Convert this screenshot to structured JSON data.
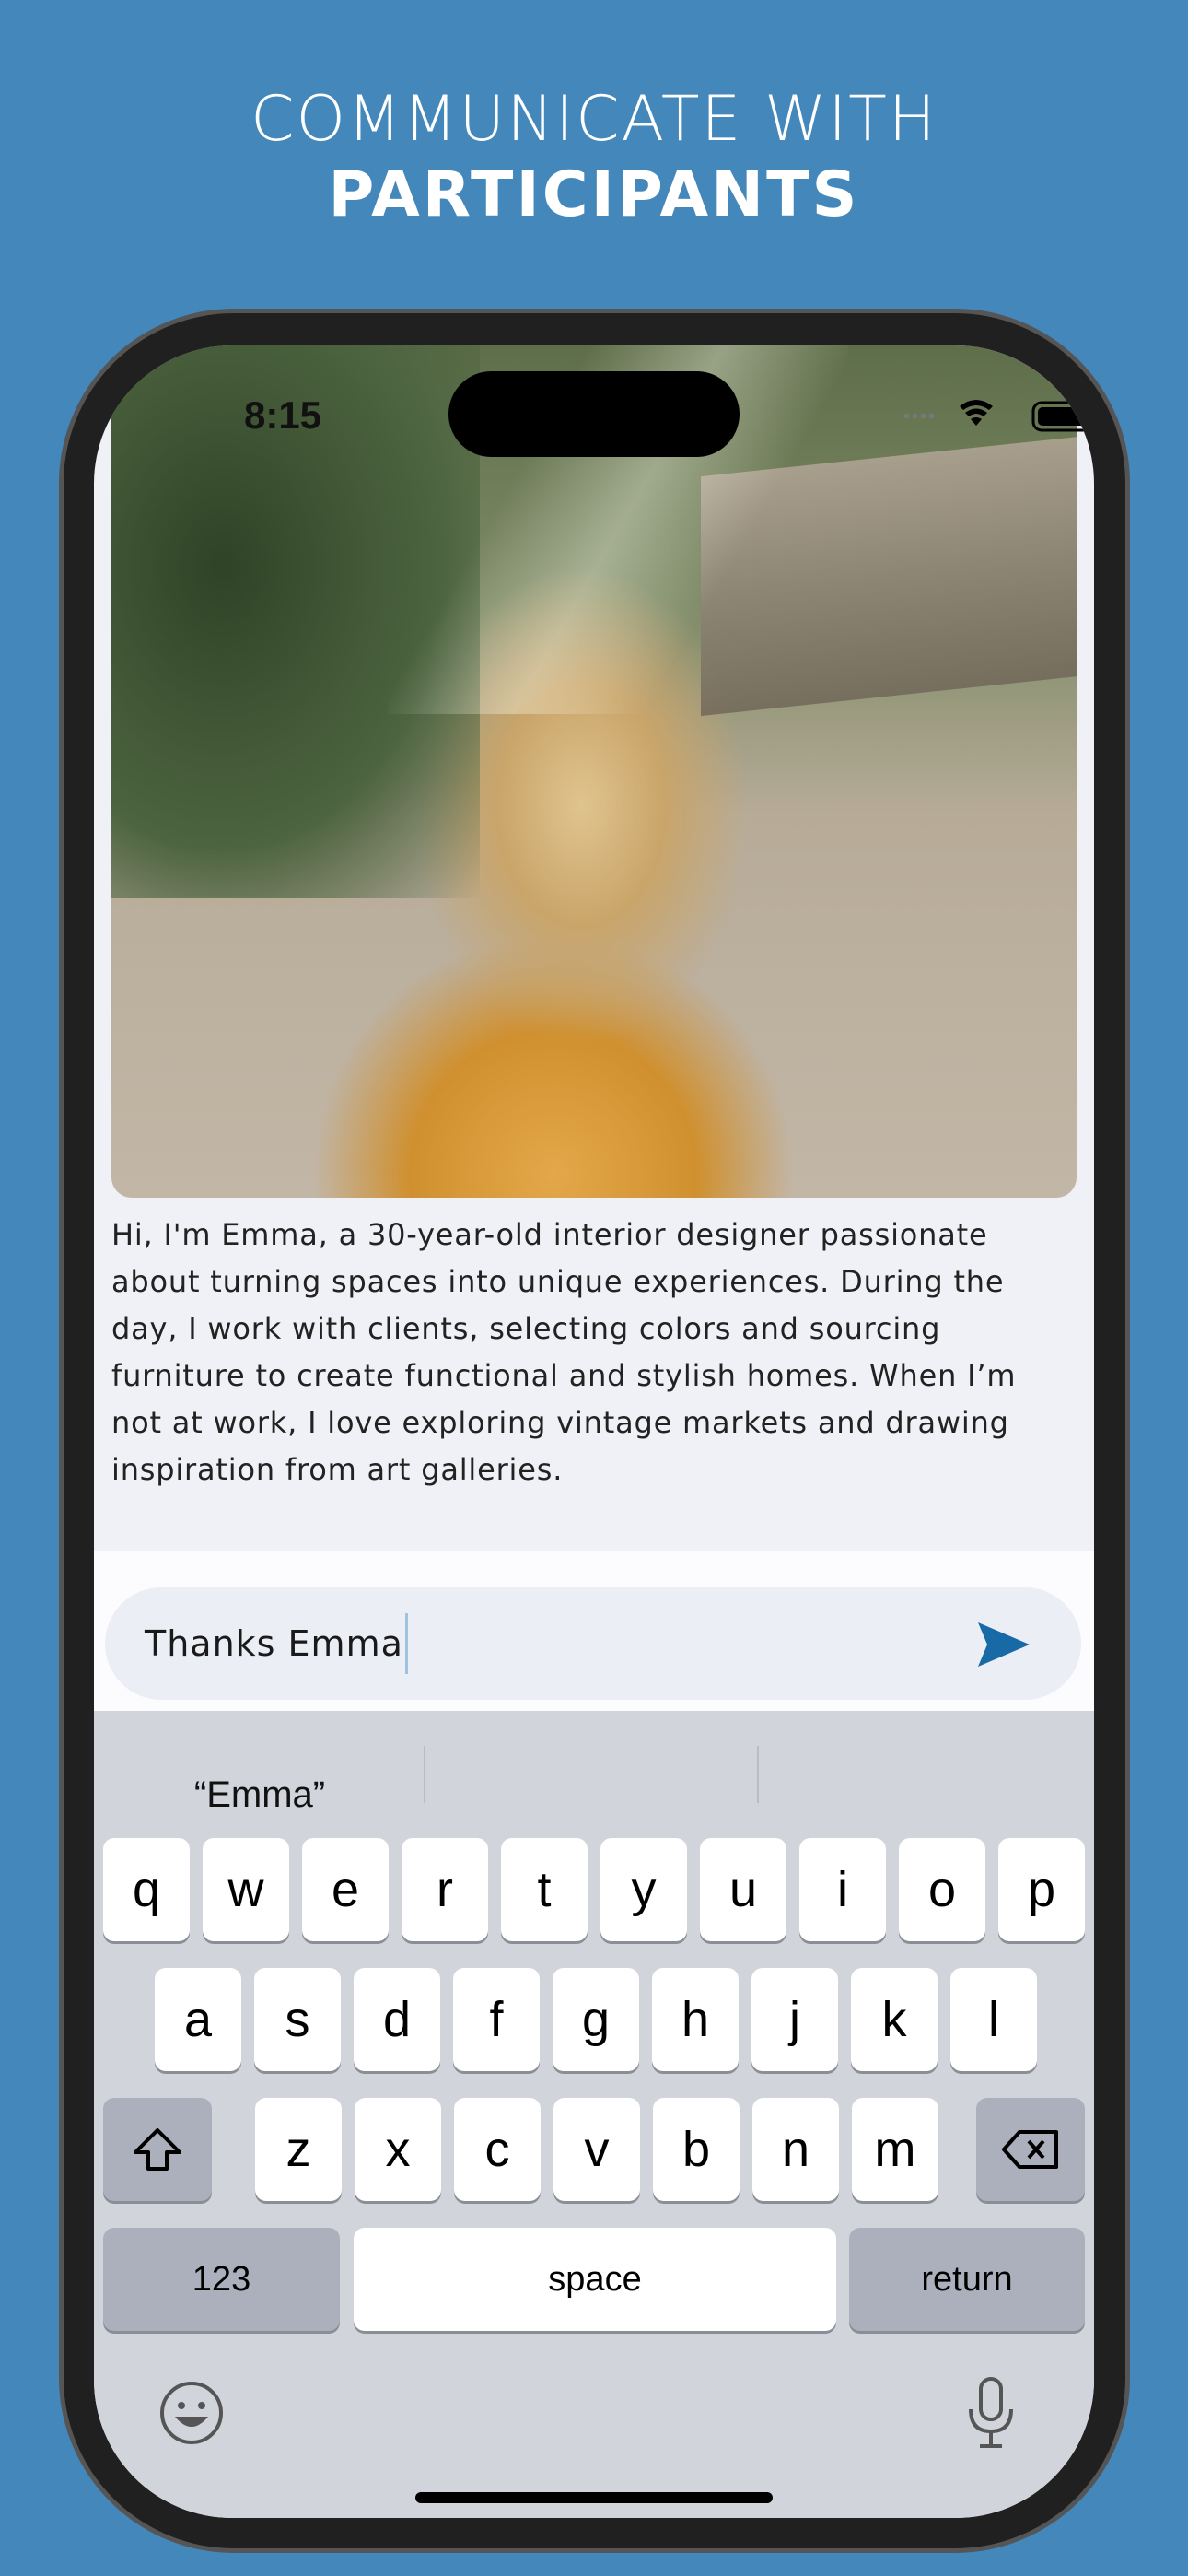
{
  "header": {
    "line1": "COMMUNICATE WITH",
    "line2": "PARTICIPANTS"
  },
  "status_bar": {
    "time": "8:15",
    "icons": [
      "signal-icon",
      "wifi-icon",
      "battery-icon"
    ]
  },
  "profile": {
    "bio": "Hi, I'm Emma, a 30-year-old interior designer passionate about turning spaces into unique experiences. During the day, I work with clients, selecting colors and sourcing furniture to create functional and stylish homes. When I’m not at work, I love exploring vintage markets and drawing inspiration from art galleries."
  },
  "composer": {
    "value": "Thanks Emma",
    "send_icon": "send-icon",
    "accent": "#176aa6"
  },
  "keyboard": {
    "suggestions": [
      "“Emma”",
      "",
      ""
    ],
    "row1": [
      "q",
      "w",
      "e",
      "r",
      "t",
      "y",
      "u",
      "i",
      "o",
      "p"
    ],
    "row2": [
      "a",
      "s",
      "d",
      "f",
      "g",
      "h",
      "j",
      "k",
      "l"
    ],
    "row3": [
      "z",
      "x",
      "c",
      "v",
      "b",
      "n",
      "m"
    ],
    "numbers": "123",
    "space": "space",
    "return": "return",
    "icons": [
      "shift-icon",
      "delete-icon",
      "emoji-icon",
      "microphone-icon"
    ]
  }
}
